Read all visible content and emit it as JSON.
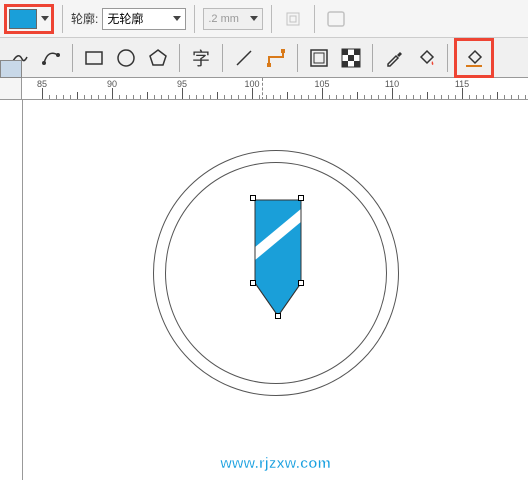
{
  "toolbar1": {
    "fill_color": "#1a9fd9",
    "outline_label": "轮廓:",
    "outline_value": "无轮廓",
    "width_value": ".2 mm"
  },
  "ruler": {
    "ticks": [
      85,
      90,
      95,
      100,
      105,
      110,
      115
    ]
  },
  "watermark": "www.rjzxw.com"
}
